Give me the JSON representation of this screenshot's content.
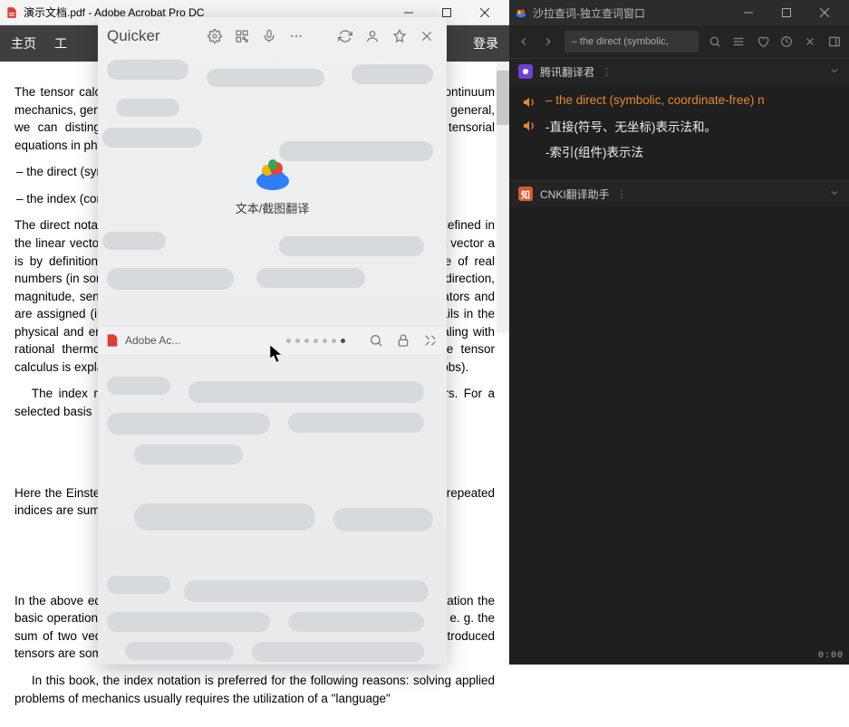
{
  "acrobat": {
    "title": "演示文档.pdf - Adobe Acrobat Pro DC",
    "tabs": [
      "主页",
      "工"
    ],
    "login": "登录",
    "paragraphs": [
      "The tensor calculus (having its origin in the works of Ricci) is often used in continuum mechanics, general relativity, differential geometry, and many other problems. In general, we can distinguish two ways of introducing the tensor calculus and the tensorial equations in physics:",
      "",
      "The direct notation operates with the tensors as with the geometrical objects defined in the linear vector space equipped with the inner product (limited to this case). A vector a is by definition an element of the linear vector space V rather than a triple of real numbers (in some basis). It is well known that a is the sum of ordered vectors (direction, magnitude, sense) or with the defined tensors are handled as the linear operators and are assigned (in the Cartesian system) quantities. This approach mostly prevails in the physical and engineering literature of mechanics and is used in textbooks dealing with rational thermodynamics, among others. The basis of this approach to the tensor calculus is explained in the books of Wilson (founded on the lecture notes of Gibbs).",
      "",
      "Here the Einstein summation convention is used, according to which the twice repeated indices are summed.",
      "In the above equation there is the right superscript and the right subscript. Notation the basic operations of linear algebra like the sum, product, change of coordinates, e. g. the sum of two vectors a + b is introduced by the components as aⁱ + bⁱ. The introduced tensors are sometimes called holors). The biggest advantage of the coordinate",
      ""
    ],
    "items": [
      "–  the direct (symbolic, coordinate-free)",
      "–  the index (component)"
    ],
    "indexLine": "The index notation deals with components (holors) of the physical tensors. For a selected basis",
    "bookLine": "In this book, the index notation is preferred for the following reasons: solving applied problems of mechanics usually requires the utilization of a \"language\""
  },
  "quicker": {
    "title": "Quicker",
    "action_label": "文本/截图翻译",
    "midbar_app": "Adobe Ac..."
  },
  "saladict": {
    "title": "沙拉查词-独立查词窗口",
    "search_preview": "– the direct (symbolic,",
    "panels": [
      {
        "name": "腾讯翻译君"
      },
      {
        "name": "CNKI翻译助手"
      }
    ],
    "result": {
      "source": "– the direct (symbolic, coordinate-free) n",
      "target1": "-直接(符号、无坐标)表示法和。",
      "target2": "-索引(组件)表示法"
    },
    "timer": "0:00"
  }
}
